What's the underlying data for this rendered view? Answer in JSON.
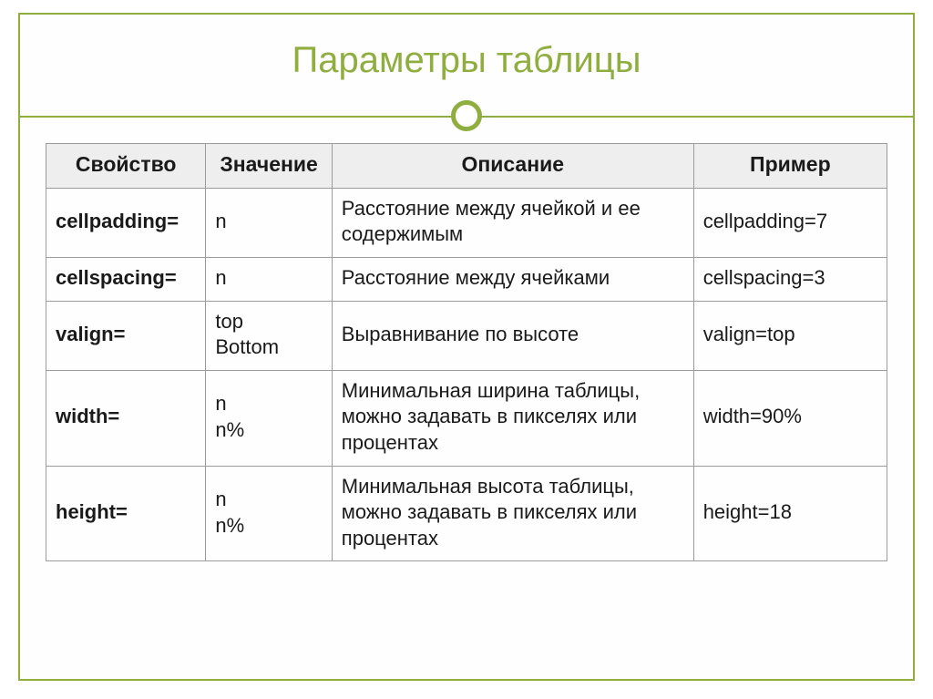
{
  "title": "Параметры таблицы",
  "headers": {
    "property": "Свойство",
    "value": "Значение",
    "description": "Описание",
    "example": "Пример"
  },
  "rows": [
    {
      "property": "cellpadding=",
      "value": "n",
      "description": "Расстояние между ячейкой и ее содержимым",
      "example": "cellpadding=7"
    },
    {
      "property": "cellspacing=",
      "value": "n",
      "description": "Расстояние между ячейками",
      "example": "cellspacing=3"
    },
    {
      "property": "valign=",
      "value": "top\nBottom",
      "description": "Выравнивание по высоте",
      "example": "valign=top"
    },
    {
      "property": "width=",
      "value": "n\nn%",
      "description": "Минимальная ширина таблицы, можно задавать в пикселях или процентах",
      "example": "width=90%"
    },
    {
      "property": "height=",
      "value": "n\nn%",
      "description": "Минимальная высота таблицы, можно задавать в пикселях или процентах",
      "example": "height=18"
    }
  ]
}
